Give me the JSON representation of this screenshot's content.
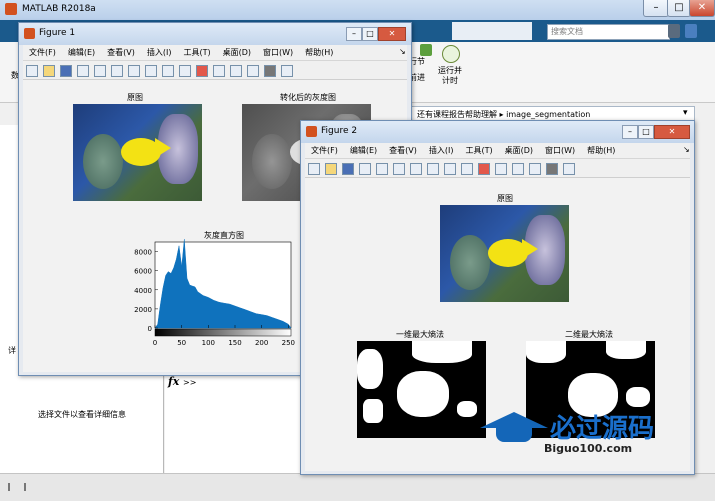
{
  "matlab": {
    "title": "MATLAB R2018a",
    "search_placeholder": "搜索文档",
    "toolstrip": {
      "run_section_label": "行节",
      "advance_label": "前进",
      "run_and_time_label": "运行并计时",
      "left_label": "数"
    },
    "current_path": "还有课程报告帮助理解 ▸ image_segmentation",
    "file_details_text": "选择文件以查看详细信息",
    "panel_label": "详",
    "command_prompt": ">>",
    "fx_label": "fx"
  },
  "figure1": {
    "title": "Figure 1",
    "menu": [
      "文件(F)",
      "编辑(E)",
      "查看(V)",
      "插入(I)",
      "工具(T)",
      "桌面(D)",
      "窗口(W)",
      "帮助(H)"
    ],
    "caption_original": "原图",
    "caption_gray": "转化后的灰度图",
    "histogram_title": "灰度直方图"
  },
  "figure2": {
    "title": "Figure 2",
    "menu": [
      "文件(F)",
      "编辑(E)",
      "查看(V)",
      "插入(I)",
      "工具(T)",
      "桌面(D)",
      "窗口(W)",
      "帮助(H)"
    ],
    "caption_original": "原图",
    "caption_1d": "一维最大熵法",
    "caption_2d": "二维最大熵法"
  },
  "watermark": {
    "text": "必过源码",
    "url": "Biguo100.com"
  },
  "chart_data": {
    "type": "area",
    "title": "灰度直方图",
    "xlim": [
      0,
      255
    ],
    "ylim": [
      0,
      9000
    ],
    "x_ticks": [
      "0",
      "50",
      "100",
      "150",
      "200",
      "250"
    ],
    "y_ticks": [
      "0",
      "2000",
      "4000",
      "6000",
      "8000"
    ],
    "x": [
      0,
      5,
      10,
      15,
      20,
      25,
      30,
      35,
      40,
      45,
      50,
      55,
      60,
      65,
      70,
      75,
      80,
      90,
      100,
      110,
      120,
      130,
      140,
      150,
      160,
      170,
      180,
      190,
      200,
      210,
      220,
      230,
      240,
      250,
      255
    ],
    "values": [
      0,
      400,
      2400,
      4200,
      5500,
      5900,
      5700,
      6300,
      7200,
      8600,
      6400,
      9300,
      5200,
      4500,
      4400,
      4300,
      3800,
      3400,
      3200,
      2900,
      2700,
      2600,
      2500,
      2300,
      2100,
      1900,
      1700,
      1500,
      1400,
      1300,
      1100,
      900,
      700,
      400,
      0
    ],
    "color": "#0f72bd",
    "grid": false
  }
}
